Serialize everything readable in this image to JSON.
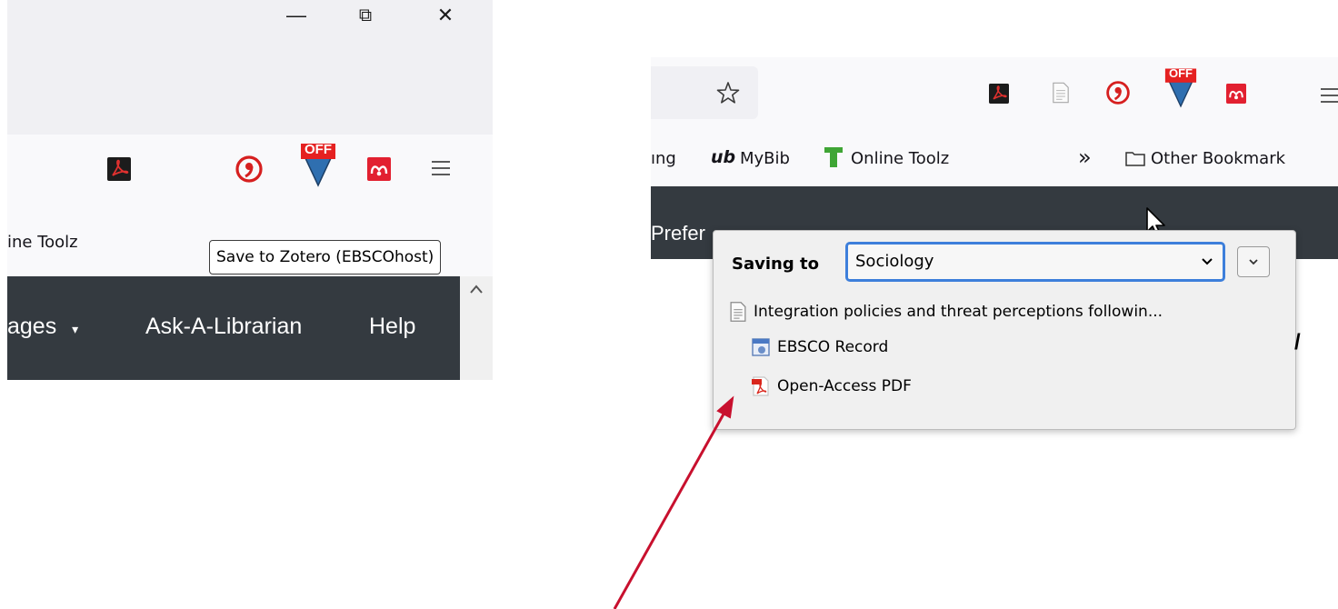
{
  "left": {
    "window_controls": {
      "minimize": "—",
      "maximize": "⧉",
      "close": "✕"
    },
    "bookmark_fragment": "ine Toolz",
    "tooltip": "Save to Zotero (EBSCOhost)",
    "off_badge": "OFF",
    "nav": {
      "images": "ages",
      "dropdown_caret": "▾",
      "ask_librarian": "Ask-A-Librarian",
      "help": "Help"
    }
  },
  "right": {
    "bookmarks": {
      "fragment": "ıng",
      "mybib_logo": "ub",
      "mybib": "MyBib",
      "online_toolz": "Online Toolz",
      "overflow": "»",
      "other_bookmarks": "Other Bookmark"
    },
    "off_badge": "OFF",
    "nav_fragment": "Prefer",
    "popup": {
      "saving_to": "Saving to",
      "collection": "Sociology",
      "expand": "⌄",
      "item_title": "Integration policies and threat perceptions followin...",
      "attachments": [
        "EBSCO Record",
        "Open-Access PDF"
      ]
    }
  },
  "colors": {
    "navbar": "#343a40",
    "toolbar": "#f9f9fb",
    "titlebar": "#f0f0f3",
    "select_border": "#3d7fdb",
    "arrow": "#c8102e"
  }
}
